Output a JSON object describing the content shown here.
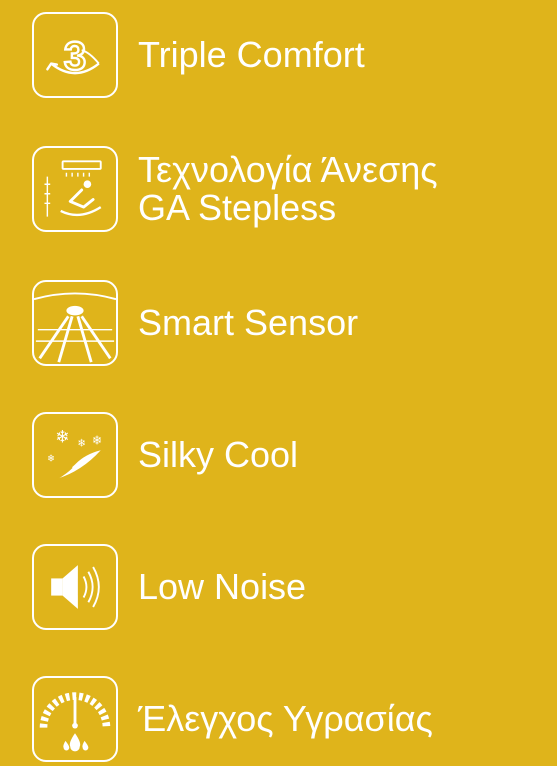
{
  "features": [
    {
      "icon": "triple-comfort-icon",
      "label": "Triple Comfort"
    },
    {
      "icon": "comfort-tech-icon",
      "label_lines": [
        "Τεχνολογία Άνεσης",
        "GA Stepless"
      ]
    },
    {
      "icon": "smart-sensor-icon",
      "label": "Smart Sensor"
    },
    {
      "icon": "silky-cool-icon",
      "label": "Silky Cool"
    },
    {
      "icon": "low-noise-icon",
      "label": "Low Noise"
    },
    {
      "icon": "humidity-control-icon",
      "label": "Έλεγχος Υγρασίας"
    }
  ],
  "colors": {
    "background": "#dfb41b",
    "foreground": "#ffffff"
  }
}
